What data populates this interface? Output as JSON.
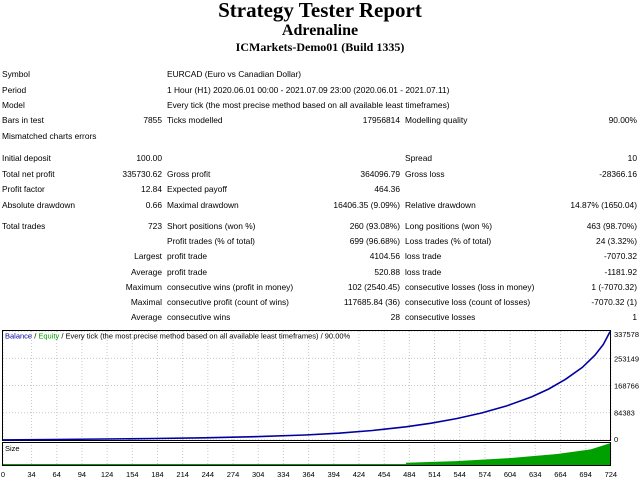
{
  "header": {
    "title": "Strategy Tester Report",
    "ea_name": "Adrenaline",
    "server": "ICMarkets-Demo01 (Build 1335)"
  },
  "info": [
    {
      "label": "Symbol",
      "value": "EURCAD (Euro vs Canadian Dollar)"
    },
    {
      "label": "Period",
      "value": "1 Hour (H1) 2020.06.01 00:00 - 2021.07.09 23:00 (2020.06.01 - 2021.07.11)"
    },
    {
      "label": "Model",
      "value": "Every tick (the most precise method based on all available least timeframes)"
    }
  ],
  "bars": {
    "label": "Bars in test",
    "value": "7855",
    "ticks_label": "Ticks modelled",
    "ticks_value": "17956814",
    "quality_label": "Modelling quality",
    "quality_value": "90.00%"
  },
  "mismatched": {
    "label": "Mismatched charts errors"
  },
  "stats1": [
    {
      "c1": "Initial deposit",
      "v1": "100.00",
      "c2": "",
      "v2": "",
      "c3": "Spread",
      "v3": "10"
    },
    {
      "c1": "Total net profit",
      "v1": "335730.62",
      "c2": "Gross profit",
      "v2": "364096.79",
      "c3": "Gross loss",
      "v3": "-28366.16"
    },
    {
      "c1": "Profit factor",
      "v1": "12.84",
      "c2": "Expected payoff",
      "v2": "464.36",
      "c3": "",
      "v3": ""
    },
    {
      "c1": "Absolute drawdown",
      "v1": "0.66",
      "c2": "Maximal drawdown",
      "v2": "16406.35 (9.09%)",
      "c3": "Relative drawdown",
      "v3": "14.87% (1650.04)"
    }
  ],
  "trades": [
    {
      "c1": "Total trades",
      "v1": "723",
      "c2": "Short positions (won %)",
      "v2": "260 (93.08%)",
      "c3": "Long positions (won %)",
      "v3": "463 (98.70%)"
    },
    {
      "c1": "",
      "v1": "",
      "c2": "Profit trades (% of total)",
      "v2": "699 (96.68%)",
      "c3": "Loss trades (% of total)",
      "v3": "24 (3.32%)"
    },
    {
      "c1": "",
      "v1": "Largest",
      "c2": "profit trade",
      "v2": "4104.56",
      "c3": "loss trade",
      "v3": "-7070.32"
    },
    {
      "c1": "",
      "v1": "Average",
      "c2": "profit trade",
      "v2": "520.88",
      "c3": "loss trade",
      "v3": "-1181.92"
    },
    {
      "c1": "",
      "v1": "Maximum",
      "c2": "consecutive wins (profit in money)",
      "v2": "102 (2540.45)",
      "c3": "consecutive losses (loss in money)",
      "v3": "1 (-7070.32)"
    },
    {
      "c1": "",
      "v1": "Maximal",
      "c2": "consecutive profit (count of wins)",
      "v2": "117685.84 (36)",
      "c3": "consecutive loss (count of losses)",
      "v3": "-7070.32 (1)"
    },
    {
      "c1": "",
      "v1": "Average",
      "c2": "consecutive wins",
      "v2": "28",
      "c3": "consecutive losses",
      "v3": "1"
    }
  ],
  "chart_data": {
    "type": "line",
    "legend": {
      "balance": "Balance",
      "separator": " / ",
      "equity": "Equity",
      "rest": " / Every tick (the most precise method based on all available least timeframes) / 90.00%"
    },
    "colors": {
      "balance": "#0000a0",
      "equity": "#00a000",
      "grid": "#c8c8c8",
      "volume": "#00a000"
    },
    "grid": true,
    "ylim": [
      -280,
      338000
    ],
    "yticks": [
      "337578",
      "253149",
      "168766",
      "84383",
      "0"
    ],
    "ytick_values": [
      337578,
      253149,
      168766,
      84383,
      0
    ],
    "xticks": [
      "0",
      "34",
      "64",
      "94",
      "124",
      "154",
      "184",
      "214",
      "244",
      "274",
      "304",
      "334",
      "364",
      "394",
      "424",
      "454",
      "484",
      "514",
      "544",
      "574",
      "604",
      "634",
      "664",
      "694",
      "724"
    ],
    "x_range": [
      0,
      723
    ],
    "balance": {
      "x": [
        0,
        60,
        120,
        180,
        240,
        300,
        360,
        400,
        440,
        480,
        510,
        540,
        570,
        600,
        630,
        650,
        670,
        690,
        705,
        715,
        723
      ],
      "y": [
        100,
        1300,
        2700,
        4400,
        6700,
        10000,
        15200,
        20900,
        29100,
        40700,
        52000,
        66000,
        83500,
        105500,
        134000,
        158000,
        188000,
        225000,
        263000,
        296000,
        335830
      ]
    },
    "volume": {
      "label": "Size",
      "x": [
        480,
        540,
        600,
        660,
        700,
        723
      ],
      "y": [
        1.0,
        1.7,
        2.9,
        4.8,
        6.8,
        9.5
      ]
    }
  }
}
